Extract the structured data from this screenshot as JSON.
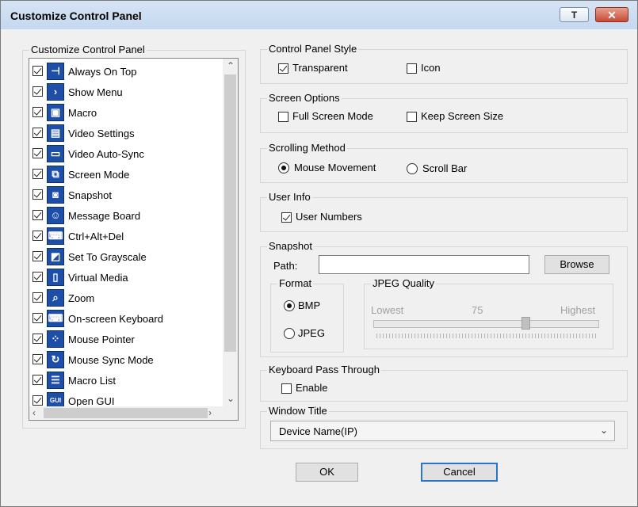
{
  "window": {
    "title": "Customize Control Panel",
    "pin_label": "T",
    "close_label": "✕"
  },
  "left_panel": {
    "group_label": "Customize Control Panel",
    "items": [
      {
        "label": "Always On Top",
        "checked": true,
        "icon": "pin-icon",
        "glyph": "⊣"
      },
      {
        "label": "Show Menu",
        "checked": true,
        "icon": "menu-arrow-icon",
        "glyph": "›"
      },
      {
        "label": "Macro",
        "checked": true,
        "icon": "macro-icon",
        "glyph": "▣"
      },
      {
        "label": "Video Settings",
        "checked": true,
        "icon": "video-settings-icon",
        "glyph": "▤"
      },
      {
        "label": "Video Auto-Sync",
        "checked": true,
        "icon": "monitor-icon",
        "glyph": "▭"
      },
      {
        "label": "Screen Mode",
        "checked": true,
        "icon": "screen-mode-icon",
        "glyph": "⧉"
      },
      {
        "label": "Snapshot",
        "checked": true,
        "icon": "camera-icon",
        "glyph": "◙"
      },
      {
        "label": "Message Board",
        "checked": true,
        "icon": "message-board-icon",
        "glyph": "☺"
      },
      {
        "label": "Ctrl+Alt+Del",
        "checked": true,
        "icon": "ctrl-alt-del-icon",
        "glyph": "⌨"
      },
      {
        "label": "Set To Grayscale",
        "checked": true,
        "icon": "grayscale-icon",
        "glyph": "◩"
      },
      {
        "label": "Virtual Media",
        "checked": true,
        "icon": "usb-icon",
        "glyph": "▯"
      },
      {
        "label": "Zoom",
        "checked": true,
        "icon": "zoom-icon",
        "glyph": "⌕"
      },
      {
        "label": "On-screen Keyboard",
        "checked": true,
        "icon": "keyboard-icon",
        "glyph": "⌨"
      },
      {
        "label": "Mouse Pointer",
        "checked": true,
        "icon": "mouse-pointer-icon",
        "glyph": "⁘"
      },
      {
        "label": "Mouse Sync Mode",
        "checked": true,
        "icon": "mouse-sync-icon",
        "glyph": "↻"
      },
      {
        "label": "Macro List",
        "checked": true,
        "icon": "macro-list-icon",
        "glyph": "☰"
      },
      {
        "label": "Open GUI",
        "checked": true,
        "icon": "gui-icon",
        "glyph": "GUI"
      }
    ]
  },
  "control_panel_style": {
    "group_label": "Control Panel Style",
    "transparent_label": "Transparent",
    "transparent_checked": true,
    "icon_label": "Icon",
    "icon_checked": false
  },
  "screen_options": {
    "group_label": "Screen Options",
    "full_screen_label": "Full Screen Mode",
    "full_screen_checked": false,
    "keep_size_label": "Keep Screen Size",
    "keep_size_checked": false
  },
  "scrolling_method": {
    "group_label": "Scrolling Method",
    "mouse_movement_label": "Mouse Movement",
    "scroll_bar_label": "Scroll Bar",
    "selected": "Mouse Movement"
  },
  "user_info": {
    "group_label": "User Info",
    "user_numbers_label": "User Numbers",
    "user_numbers_checked": true
  },
  "snapshot": {
    "group_label": "Snapshot",
    "path_label": "Path:",
    "path_value": "",
    "browse_label": "Browse",
    "format_label": "Format",
    "bmp_label": "BMP",
    "jpeg_label": "JPEG",
    "format_selected": "BMP",
    "jpeg_quality_label": "JPEG Quality",
    "lowest_label": "Lowest",
    "quality_value": "75",
    "highest_label": "Highest",
    "quality_fraction": 0.68
  },
  "keyboard_pass_through": {
    "group_label": "Keyboard Pass Through",
    "enable_label": "Enable",
    "enable_checked": false
  },
  "window_title": {
    "group_label": "Window Title",
    "selected": "Device Name(IP)"
  },
  "buttons": {
    "ok_label": "OK",
    "cancel_label": "Cancel"
  }
}
